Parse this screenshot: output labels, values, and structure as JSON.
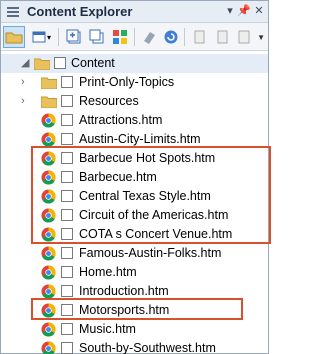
{
  "window": {
    "title": "Content Explorer"
  },
  "tree": {
    "root": "Content",
    "items": [
      {
        "label": "Print-Only-Topics",
        "type": "folder",
        "expandable": true
      },
      {
        "label": "Resources",
        "type": "folder",
        "expandable": true
      },
      {
        "label": "Attractions.htm",
        "type": "file"
      },
      {
        "label": "Austin-City-Limits.htm",
        "type": "file"
      },
      {
        "label": "Barbecue Hot Spots.htm",
        "type": "file"
      },
      {
        "label": "Barbecue.htm",
        "type": "file"
      },
      {
        "label": "Central Texas Style.htm",
        "type": "file"
      },
      {
        "label": "Circuit of the Americas.htm",
        "type": "file"
      },
      {
        "label": "COTA s Concert Venue.htm",
        "type": "file"
      },
      {
        "label": "Famous-Austin-Folks.htm",
        "type": "file"
      },
      {
        "label": "Home.htm",
        "type": "file"
      },
      {
        "label": "Introduction.htm",
        "type": "file"
      },
      {
        "label": "Motorsports.htm",
        "type": "file"
      },
      {
        "label": "Music.htm",
        "type": "file"
      },
      {
        "label": "South-by-Southwest.htm",
        "type": "file"
      }
    ]
  },
  "colors": {
    "highlight": "#d9512c",
    "folder": "#e8c15c",
    "titlebar": "#e7edf5"
  }
}
